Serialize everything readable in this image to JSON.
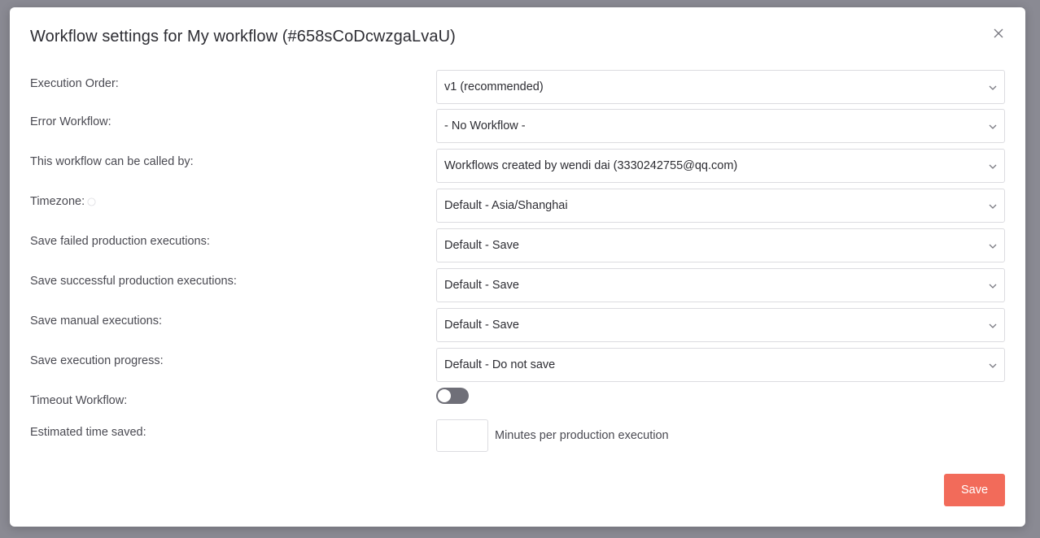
{
  "modal": {
    "title": "Workflow settings for My workflow (#658sCoDcwzgaLvaU)"
  },
  "settings": [
    {
      "label": "Execution Order:",
      "value": "v1 (recommended)"
    },
    {
      "label": "Error Workflow:",
      "value": "- No Workflow -"
    },
    {
      "label": "This workflow can be called by:",
      "value": "Workflows created by wendi dai (3330242755@qq.com)"
    },
    {
      "label": "Timezone:",
      "value": "Default - Asia/Shanghai"
    },
    {
      "label": "Save failed production executions:",
      "value": "Default - Save"
    },
    {
      "label": "Save successful production executions:",
      "value": "Default - Save"
    },
    {
      "label": "Save manual executions:",
      "value": "Default - Save"
    },
    {
      "label": "Save execution progress:",
      "value": "Default - Do not save"
    }
  ],
  "timeout": {
    "label": "Timeout Workflow:",
    "enabled": false
  },
  "estimated": {
    "label": "Estimated time saved:",
    "value": "",
    "suffix": "Minutes per production execution"
  },
  "footer": {
    "save_label": "Save"
  },
  "colors": {
    "accent": "#f26b5a",
    "toggle_off": "#6f6f78"
  }
}
